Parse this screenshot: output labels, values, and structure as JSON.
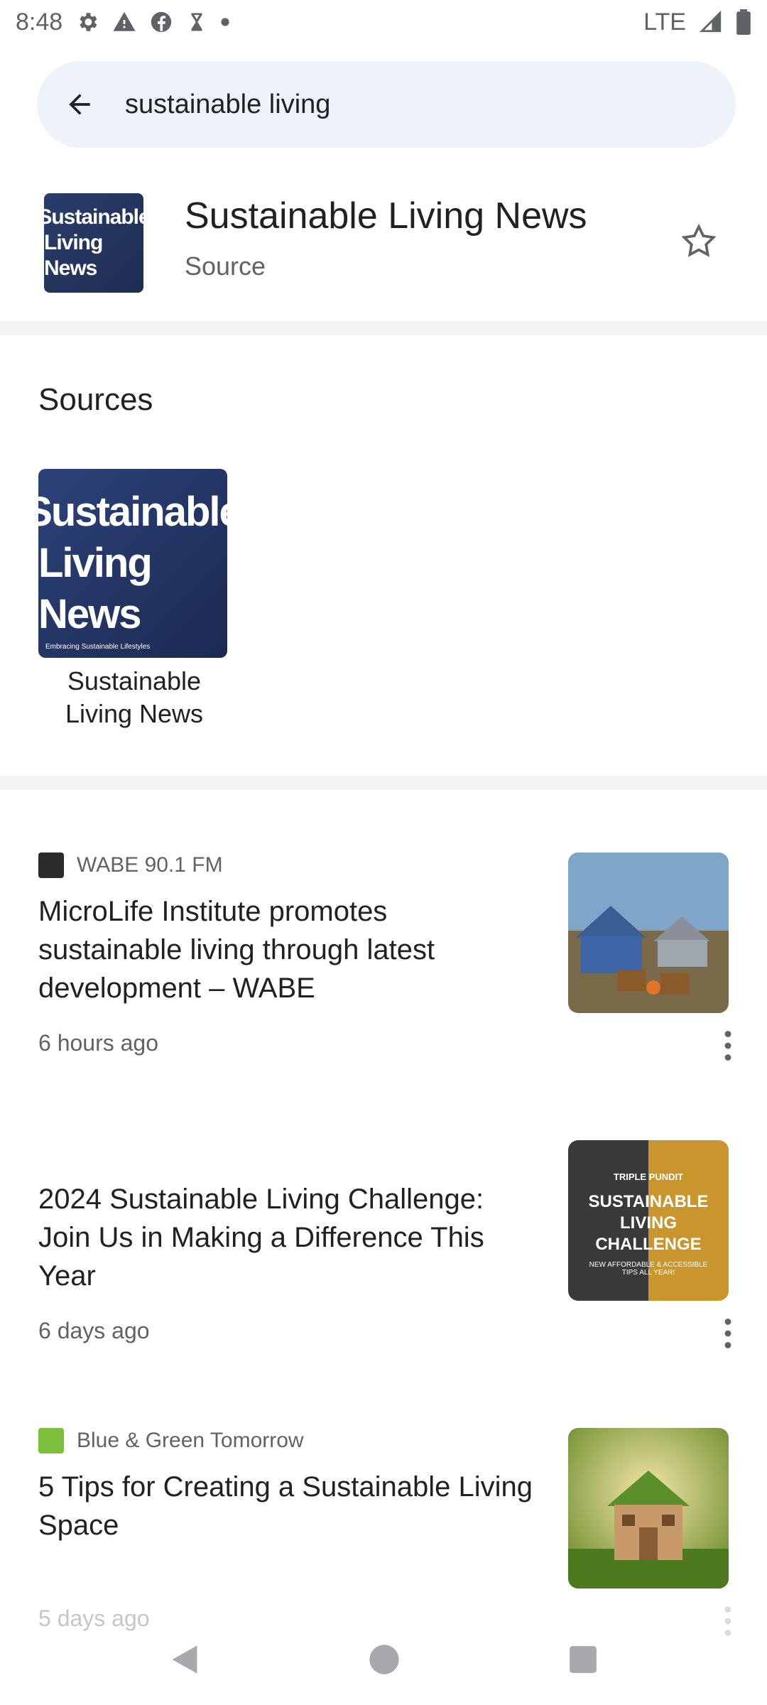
{
  "status_bar": {
    "time": "8:48",
    "network": "LTE",
    "icons": [
      "settings-icon",
      "warning-icon",
      "facebook-icon",
      "hourglass-icon",
      "dot-icon",
      "signal-icon",
      "battery-icon"
    ]
  },
  "search": {
    "value": "sustainable living",
    "back_icon": "arrow-back-icon"
  },
  "topic": {
    "title": "Sustainable Living News",
    "subtitle": "Source",
    "thumb_line1": "Sustainable",
    "thumb_line2": "Living News",
    "action_icon": "star-outline-icon"
  },
  "sources": {
    "heading": "Sources",
    "items": [
      {
        "label": "Sustainable Living News",
        "thumb_line1": "Sustainable",
        "thumb_line2": "Living News",
        "thumb_caption": "Embracing Sustainable Lifestyles"
      }
    ]
  },
  "articles": [
    {
      "publisher": "WABE 90.1 FM",
      "headline": "MicroLife Institute promotes sustainable living through latest development – WABE",
      "time": "6 hours ago"
    },
    {
      "publisher": "",
      "headline": "2024 Sustainable Living Challenge: Join Us in Making a Difference This Year",
      "time": "6 days ago",
      "thumb_top": "TRIPLE PUNDIT",
      "thumb_mid": "SUSTAINABLE LIVING CHALLENGE",
      "thumb_bottom": "NEW AFFORDABLE & ACCESSIBLE TIPS ALL YEAR!"
    },
    {
      "publisher": "Blue & Green Tomorrow",
      "headline": "5 Tips for Creating a Sustainable Living Space",
      "time": "5 days ago"
    }
  ],
  "colors": {
    "search_bg": "#eef2f9",
    "divider": "#f1f3f4",
    "text_primary": "#202124",
    "text_secondary": "#5f6368"
  }
}
